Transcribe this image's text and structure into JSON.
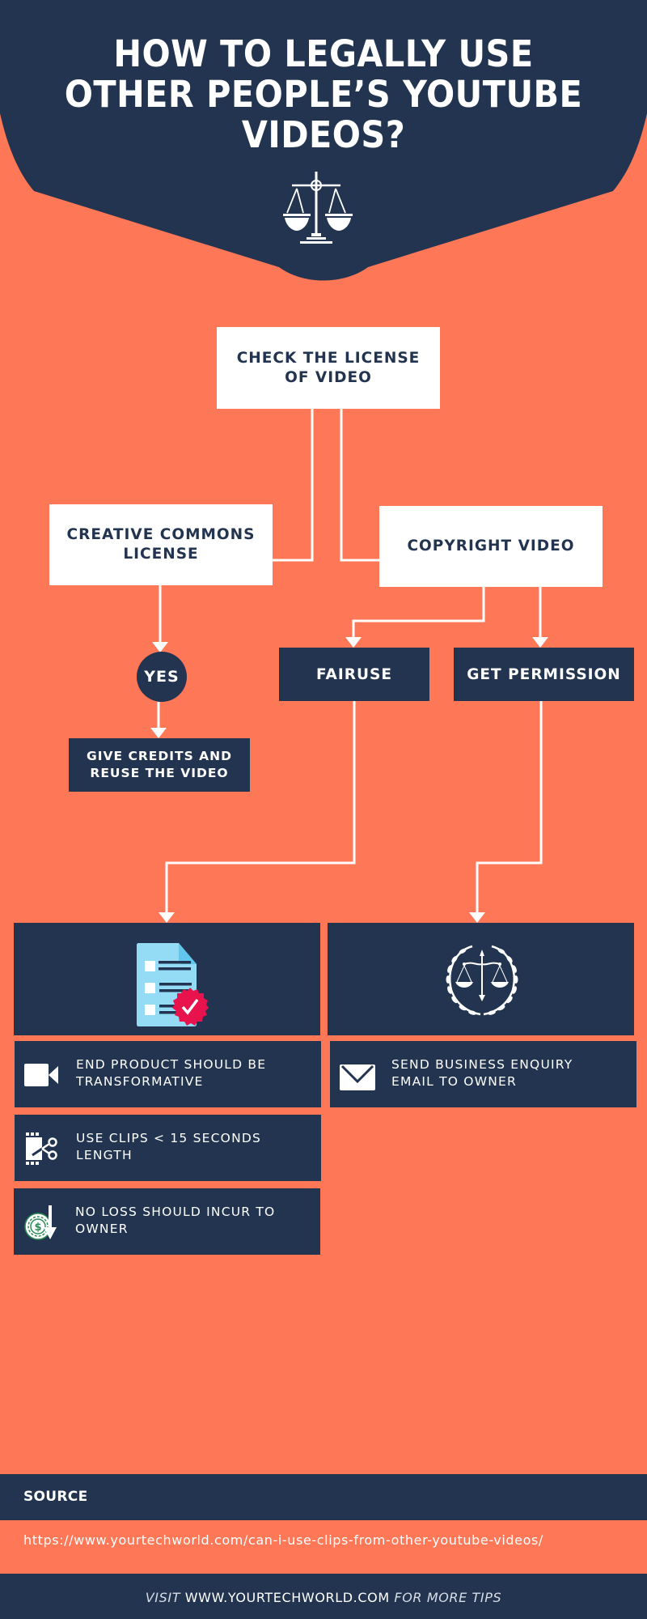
{
  "colors": {
    "background": "#fe7756",
    "navy": "#22344f",
    "white": "#ffffff",
    "doc_blue": "#94dcf6",
    "doc_fold": "#62c7ef",
    "badge_red": "#e8124c",
    "coin_green": "#2e8b57"
  },
  "header": {
    "title_lines": [
      "HOW TO LEGALLY USE",
      "OTHER PEOPLE’S YOUTUBE",
      "VIDEOS?"
    ],
    "icon": "scales-of-justice-icon"
  },
  "flowchart": {
    "start": {
      "lines": [
        "CHECK THE LICENSE",
        "OF VIDEO"
      ]
    },
    "branches": {
      "creative_commons": {
        "lines": [
          "CREATIVE COMMONS",
          "LICENSE"
        ]
      },
      "copyright": {
        "lines": [
          "COPYRIGHT VIDEO"
        ]
      }
    },
    "yes": {
      "label": "YES"
    },
    "credits": {
      "lines": [
        "GIVE CREDITS AND",
        "REUSE THE VIDEO"
      ]
    },
    "fairuse": {
      "label": "FAIRUSE"
    },
    "permission": {
      "label": "GET PERMISSION"
    }
  },
  "panels": {
    "fairuse": {
      "icon": "checklist-document-icon",
      "tips": [
        {
          "icon": "video-camera-icon",
          "lines": [
            "END PRODUCT SHOULD BE",
            "TRANSFORMATIVE"
          ]
        },
        {
          "icon": "film-scissors-icon",
          "lines": [
            "USE CLIPS < 15 SECONDS",
            "LENGTH"
          ]
        },
        {
          "icon": "coin-loss-icon",
          "lines": [
            "NO LOSS SHOULD INCUR TO",
            "OWNER"
          ]
        }
      ]
    },
    "permission": {
      "icon": "laurel-justice-icon",
      "tips": [
        {
          "icon": "envelope-icon",
          "lines": [
            "SEND BUSINESS ENQUIRY",
            "EMAIL TO OWNER"
          ]
        }
      ]
    }
  },
  "source": {
    "label": "SOURCE",
    "url": "https://www.yourtechworld.com/can-i-use-clips-from-other-youtube-videos/"
  },
  "footer": {
    "prefix": "VISIT",
    "site": "WWW.YOURTECHWORLD.COM",
    "suffix": "FOR MORE TIPS"
  }
}
